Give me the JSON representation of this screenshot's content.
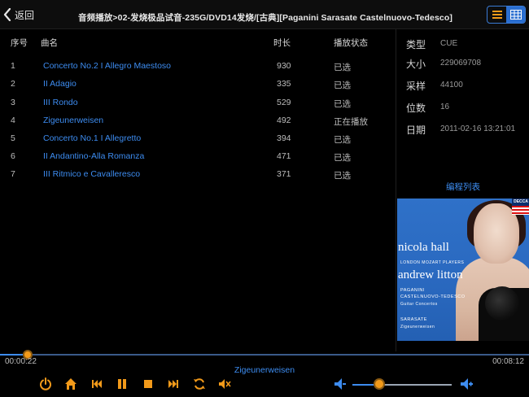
{
  "header": {
    "back_label": "返回",
    "title": "音频播放>02-发烧极品试音-235G/DVD14发烧/[古典][Paganini Sarasate Castelnuovo-Tedesco]"
  },
  "columns": {
    "index": "序号",
    "name": "曲名",
    "duration": "时长",
    "status": "播放状态"
  },
  "tracks": [
    {
      "index": "1",
      "name": "Concerto No.2 I Allegro Maestoso",
      "duration": "930",
      "status": "已选"
    },
    {
      "index": "2",
      "name": "II Adagio",
      "duration": "335",
      "status": "已选"
    },
    {
      "index": "3",
      "name": "III Rondo",
      "duration": "529",
      "status": "已选"
    },
    {
      "index": "4",
      "name": "Zigeunerweisen",
      "duration": "492",
      "status": "正在播放"
    },
    {
      "index": "5",
      "name": "Concerto No.1 I Allegretto",
      "duration": "394",
      "status": "已选"
    },
    {
      "index": "6",
      "name": "II Andantino-Alla Romanza",
      "duration": "471",
      "status": "已选"
    },
    {
      "index": "7",
      "name": "III Ritmico e Cavalleresco",
      "duration": "371",
      "status": "已选"
    }
  ],
  "info": {
    "type_label": "类型",
    "type_value": "CUE",
    "size_label": "大小",
    "size_value": "229069708",
    "rate_label": "采样",
    "rate_value": "44100",
    "bits_label": "位数",
    "bits_value": "16",
    "date_label": "日期",
    "date_value": "2011-02-16 13:21:01"
  },
  "program_list_label": "编程列表",
  "cover": {
    "brand": "DECCA",
    "artist1": "nicola hall",
    "orchestra": "LONDON MOZART PLAYERS",
    "artist2": "andrew litton",
    "composer1": "PAGANINI",
    "composer2": "CASTELNUOVO-TEDESCO",
    "work1": "Guitar Concertos",
    "composer3": "SARASATE",
    "work2": "Zigeunerweisen"
  },
  "player": {
    "elapsed": "00:00:22",
    "total": "00:08:12",
    "progress": 0.045,
    "now_playing": "Zigeunerweisen",
    "volume": 0.27
  },
  "colors": {
    "accent_blue": "#3d8cf0",
    "control_orange": "#f29a1a",
    "background": "#000000"
  },
  "icons": [
    "back-chevron-icon",
    "list-view-icon",
    "grid-view-icon",
    "power-icon",
    "home-icon",
    "previous-icon",
    "pause-icon",
    "stop-icon",
    "next-icon",
    "repeat-icon",
    "mute-icon",
    "volume-down-icon",
    "volume-up-icon"
  ]
}
